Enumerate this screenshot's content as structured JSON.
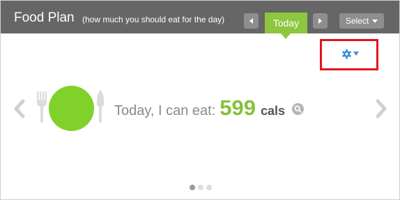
{
  "header": {
    "title": "Food Plan",
    "subtitle": "(how much you should eat for the day)",
    "today_label": "Today",
    "select_label": "Select"
  },
  "summary": {
    "lead_text": "Today, I can eat:",
    "calories": "599",
    "unit": "cals"
  },
  "icons": {
    "settings": "gear-icon",
    "zoom": "magnifier-icon",
    "prev_day": "triangle-left-icon",
    "next_day": "triangle-right-icon",
    "carousel_prev": "chevron-left-icon",
    "carousel_next": "chevron-right-icon",
    "fork": "fork-icon",
    "knife": "knife-icon"
  },
  "pagination": {
    "total": 3,
    "active": 1
  },
  "colors": {
    "header_bg": "#666666",
    "accent_green": "#8dc63f",
    "plate_green": "#80d22a",
    "highlight_red": "#e3131b",
    "settings_blue": "#3a8fde"
  }
}
